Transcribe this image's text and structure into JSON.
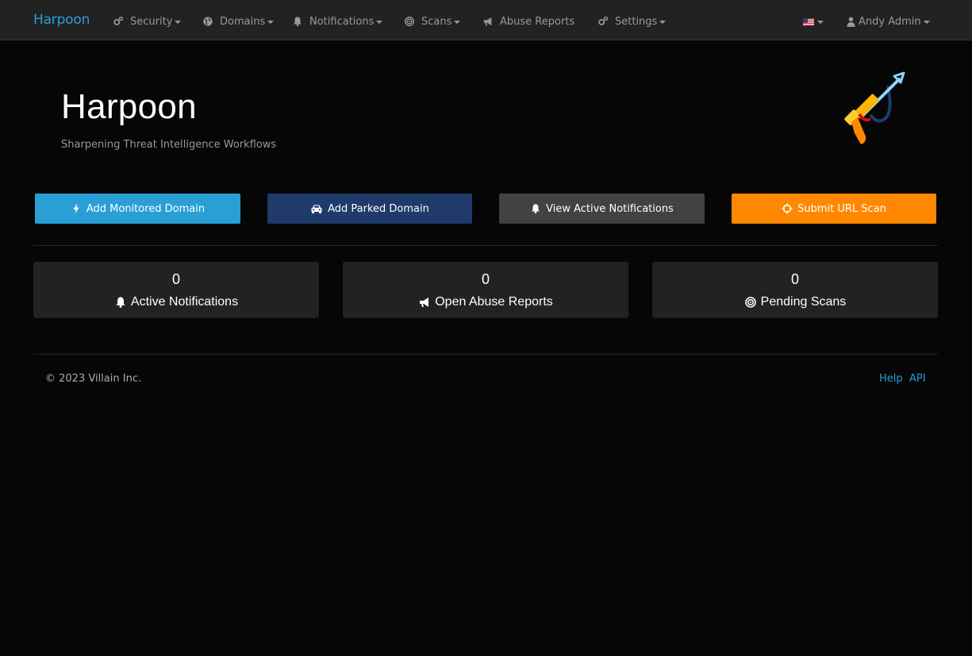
{
  "navbar": {
    "brand": "Harpoon",
    "items": [
      {
        "label": "Security",
        "icon": "cogs-icon"
      },
      {
        "label": "Domains",
        "icon": "globe-icon"
      },
      {
        "label": "Notifications",
        "icon": "bell-icon"
      },
      {
        "label": "Scans",
        "icon": "bullseye-icon"
      },
      {
        "label": "Abuse Reports",
        "icon": "bullhorn-icon"
      },
      {
        "label": "Settings",
        "icon": "cogs-icon"
      }
    ],
    "language_icon": "us-flag-icon",
    "user": {
      "label": "Andy Admin",
      "icon": "user-icon"
    }
  },
  "header": {
    "title": "Harpoon",
    "subtitle": "Sharpening Threat Intelligence Workflows",
    "logo": "harpoon-gun-logo"
  },
  "actions": [
    {
      "label": "Add Monitored Domain",
      "icon": "bolt-icon",
      "color": "#2a9fd6"
    },
    {
      "label": "Add Parked Domain",
      "icon": "car-icon",
      "color": "#1f3a6b"
    },
    {
      "label": "View Active Notifications",
      "icon": "bell-icon",
      "color": "#424242"
    },
    {
      "label": "Submit URL Scan",
      "icon": "crosshairs-icon",
      "color": "#ff8800"
    }
  ],
  "stats": [
    {
      "count": "0",
      "label": "Active Notifications",
      "icon": "bell-icon"
    },
    {
      "count": "0",
      "label": "Open Abuse Reports",
      "icon": "bullhorn-icon"
    },
    {
      "count": "0",
      "label": "Pending Scans",
      "icon": "bullseye-icon"
    }
  ],
  "footer": {
    "copyright": "© 2023 Villain Inc.",
    "links": [
      "Help",
      "API"
    ]
  },
  "colors": {
    "accent": "#2a9fd6",
    "navbar_bg": "#222222",
    "page_bg": "#060606",
    "warning": "#ff8800"
  }
}
